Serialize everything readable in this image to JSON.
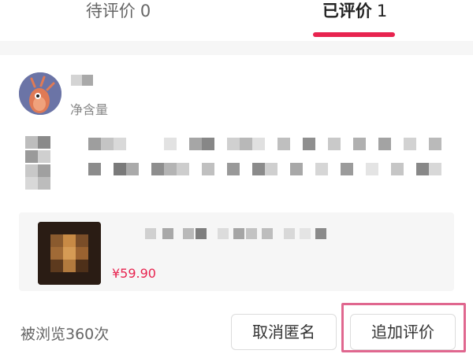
{
  "tabs": {
    "pending": {
      "label": "待评价",
      "count": "0"
    },
    "done": {
      "label": "已评价",
      "count": "1"
    }
  },
  "review": {
    "spec_label": "净含量",
    "avatar_icon": "shrimp-avatar-icon",
    "views": "被浏览360次"
  },
  "product": {
    "price": "¥59.90"
  },
  "actions": {
    "cancel_anonymous": "取消匿名",
    "add_review": "追加评价"
  },
  "colors": {
    "accent": "#e8234f",
    "highlight": "#e0678f"
  }
}
